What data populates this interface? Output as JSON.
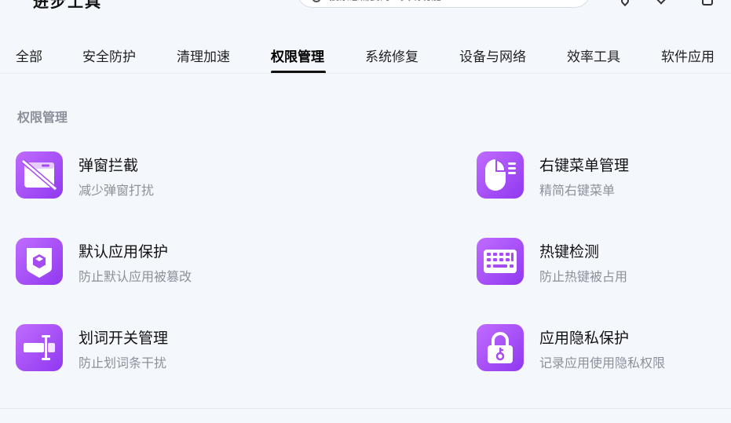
{
  "header": {
    "app_title": "进步工具",
    "search_placeholder": "搜索您需要的工具或功能"
  },
  "tabs": [
    {
      "label": "全部"
    },
    {
      "label": "安全防护"
    },
    {
      "label": "清理加速"
    },
    {
      "label": "权限管理"
    },
    {
      "label": "系统修复"
    },
    {
      "label": "设备与网络"
    },
    {
      "label": "效率工具"
    },
    {
      "label": "软件应用"
    }
  ],
  "active_tab": "权限管理",
  "section": {
    "title": "权限管理",
    "tools": [
      {
        "title": "弹窗拦截",
        "desc": "减少弹窗打扰",
        "icon": "popup-block-icon"
      },
      {
        "title": "右键菜单管理",
        "desc": "精简右键菜单",
        "icon": "right-click-mouse-icon"
      },
      {
        "title": "默认应用保护",
        "desc": "防止默认应用被篡改",
        "icon": "shield-cube-icon"
      },
      {
        "title": "热键检测",
        "desc": "防止热键被占用",
        "icon": "keyboard-icon"
      },
      {
        "title": "划词开关管理",
        "desc": "防止划词条干扰",
        "icon": "text-select-icon"
      },
      {
        "title": "应用隐私保护",
        "desc": "记录应用使用隐私权限",
        "icon": "lock-key-icon"
      }
    ]
  },
  "colors": {
    "accent_gradient_start": "#c06cff",
    "accent_gradient_end": "#9038f0",
    "background": "#f4f8fd"
  }
}
